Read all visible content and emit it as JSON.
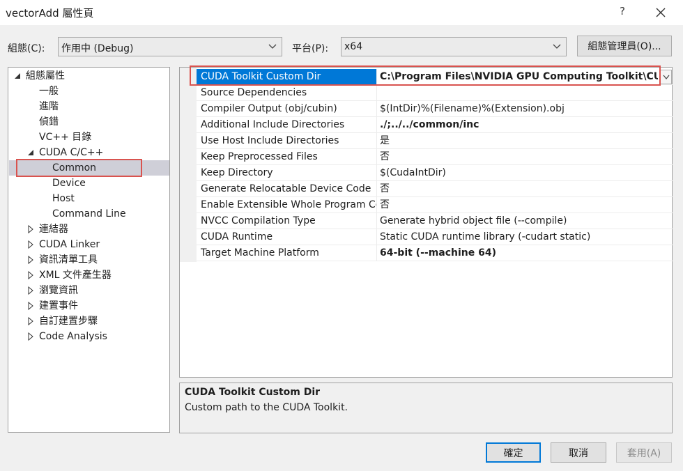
{
  "window": {
    "title": "vectorAdd 屬性頁",
    "help_label": "?"
  },
  "top_bar": {
    "config_label": "組態(C):",
    "config_value": "作用中 (Debug)",
    "platform_label": "平台(P):",
    "platform_value": "x64",
    "config_manager_label": "組態管理員(O)..."
  },
  "tree": {
    "items": [
      {
        "label": "組態屬性",
        "expander": "expanded"
      },
      {
        "label": "一般",
        "expander": "none"
      },
      {
        "label": "進階",
        "expander": "none"
      },
      {
        "label": "偵錯",
        "expander": "none"
      },
      {
        "label": "VC++ 目錄",
        "expander": "none"
      },
      {
        "label": "CUDA C/C++",
        "expander": "expanded"
      },
      {
        "label": "Common",
        "expander": "none",
        "selected": true
      },
      {
        "label": "Device",
        "expander": "none"
      },
      {
        "label": "Host",
        "expander": "none"
      },
      {
        "label": "Command Line",
        "expander": "none"
      },
      {
        "label": "連結器",
        "expander": "collapsed"
      },
      {
        "label": "CUDA Linker",
        "expander": "collapsed"
      },
      {
        "label": "資訊清單工具",
        "expander": "collapsed"
      },
      {
        "label": "XML 文件產生器",
        "expander": "collapsed"
      },
      {
        "label": "瀏覽資訊",
        "expander": "collapsed"
      },
      {
        "label": "建置事件",
        "expander": "collapsed"
      },
      {
        "label": "自訂建置步驟",
        "expander": "collapsed"
      },
      {
        "label": "Code Analysis",
        "expander": "collapsed"
      }
    ]
  },
  "properties": {
    "rows": [
      {
        "name": "CUDA Toolkit Custom Dir",
        "value": "C:\\Program Files\\NVIDIA GPU Computing Toolkit\\CUDA\\",
        "selected": true
      },
      {
        "name": "Source Dependencies",
        "value": ""
      },
      {
        "name": "Compiler Output (obj/cubin)",
        "value": "$(IntDir)%(Filename)%(Extension).obj"
      },
      {
        "name": "Additional Include Directories",
        "value": "./;../../common/inc",
        "bold": true
      },
      {
        "name": "Use Host Include Directories",
        "value": "是"
      },
      {
        "name": "Keep Preprocessed Files",
        "value": "否"
      },
      {
        "name": "Keep Directory",
        "value": "$(CudaIntDir)"
      },
      {
        "name": "Generate Relocatable Device Code",
        "value": "否"
      },
      {
        "name": "Enable Extensible Whole Program Compilation",
        "value": "否"
      },
      {
        "name": "NVCC Compilation Type",
        "value": "Generate hybrid object file (--compile)"
      },
      {
        "name": "CUDA Runtime",
        "value": "Static CUDA runtime library (-cudart static)"
      },
      {
        "name": "Target Machine Platform",
        "value": "64-bit (--machine 64)",
        "bold": true
      }
    ]
  },
  "description": {
    "title": "CUDA Toolkit Custom Dir",
    "text": "Custom path to the CUDA Toolkit."
  },
  "footer": {
    "ok_label": "確定",
    "cancel_label": "取消",
    "apply_label": "套用(A)"
  },
  "colors": {
    "selection_blue": "#0078d7",
    "highlight_red": "#d9534f",
    "tree_selected": "#cfcfd8"
  }
}
